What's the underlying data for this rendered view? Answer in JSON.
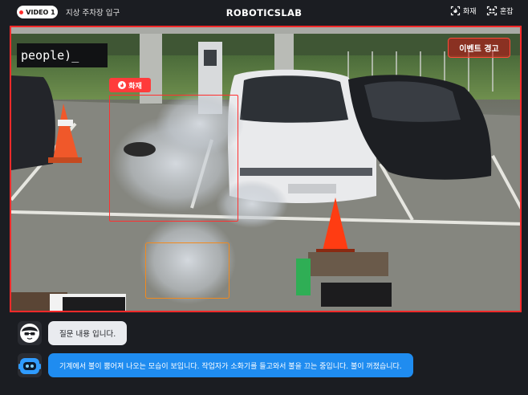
{
  "header": {
    "video_badge": "VIDEO 1",
    "location": "지상 주차장 입구",
    "brand": "ROBOTICSLAB",
    "filters": [
      {
        "label": "화재",
        "icon": "fire-alarm-icon"
      },
      {
        "label": "혼잡",
        "icon": "crowd-icon"
      }
    ]
  },
  "video": {
    "event_alert": "이벤트 경고",
    "overlay_label": "people)_",
    "detection_label": "화재",
    "detection_icon": "fire-icon",
    "colors": {
      "alert": "#ff2a2a",
      "smoke_box": "#f28a1e"
    }
  },
  "chat": {
    "messages": [
      {
        "role": "user",
        "text": "질문 내용 입니다.",
        "avatar": "user-avatar-icon"
      },
      {
        "role": "bot",
        "text": "기계에서 불이 뿜어져 나오는 모습이 보입니다. 작업자가 소화기를 들고와서 불을 끄는 중입니다. 불이 꺼졌습니다.",
        "avatar": "robot-avatar-icon"
      }
    ]
  }
}
